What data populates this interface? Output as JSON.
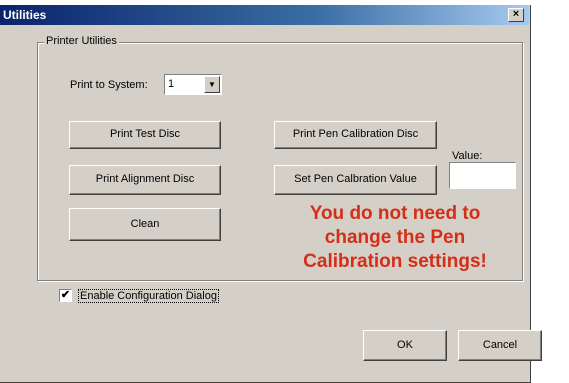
{
  "window": {
    "title": "Utilities",
    "close_glyph": "×"
  },
  "group": {
    "label": "Printer Utilities"
  },
  "print_to_system": {
    "label": "Print to System:",
    "value": "1",
    "arrow_glyph": "▼"
  },
  "buttons": {
    "print_test_disc": "Print Test Disc",
    "print_alignment_disc": "Print Alignment Disc",
    "clean": "Clean",
    "print_pen_calibration_disc": "Print Pen Calibration Disc",
    "set_pen_calibration_value": "Set Pen Calbration Value",
    "ok": "OK",
    "cancel": "Cancel"
  },
  "value_field": {
    "label": "Value:",
    "value": ""
  },
  "notice": {
    "line1": "You do not need to",
    "line2": "change the Pen",
    "line3": "Calibration settings!"
  },
  "enable_config": {
    "label": "Enable Configuration Dialog",
    "checked": true,
    "check_glyph": "✔"
  },
  "colors": {
    "notice_red": "#d52e17",
    "title_blue": "#0a246a",
    "dialog_gray": "#d4d0c8"
  }
}
